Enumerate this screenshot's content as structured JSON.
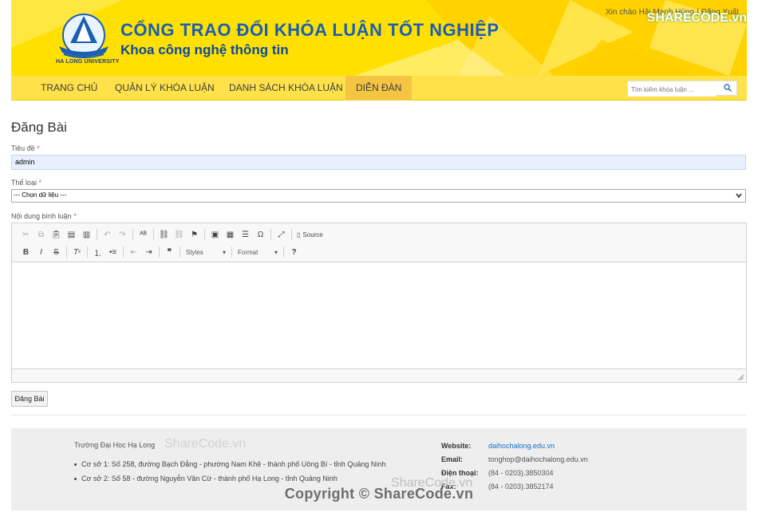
{
  "header": {
    "logo_caption": "HA LONG UNIVERSITY",
    "title": "CỔNG TRAO ĐỔI KHÓA LUẬN TỐT NGHIỆP",
    "subtitle": "Khoa công nghệ thông tin",
    "greeting_prefix": "Xin chào",
    "greeting_user": "Hải Mạnh Hùng",
    "logout": "Đăng Xuất",
    "watermark": "SHARECODE.vn"
  },
  "nav": {
    "items": [
      {
        "label": "TRANG CHỦ"
      },
      {
        "label": "QUẢN LÝ KHÓA LUẬN"
      },
      {
        "label": "DANH SÁCH KHÓA LUẬN"
      },
      {
        "label": "DIỄN ĐÀN"
      }
    ],
    "active_index": 3,
    "search_placeholder": "Tìm kiếm khóa luận ..."
  },
  "form": {
    "heading": "Đăng Bài",
    "title_label": "Tiêu đề",
    "title_value": "admin",
    "category_label": "Thể loại",
    "category_selected": "--- Chọn dữ liệu ---",
    "content_label": "Nội dung bình luận",
    "required_mark": "*",
    "submit_label": "Đăng Bài"
  },
  "editor": {
    "styles_label": "Styles",
    "format_label": "Format",
    "source_label": "Source"
  },
  "footer": {
    "school": "Trường Đại Học Hạ Long",
    "campuses": [
      "Cơ sở 1: Số 258, đường Bạch Đằng - phường Nam Khê - thành phố Uông Bí - tỉnh Quảng Ninh",
      "Cơ sở 2: Số 58 - đường Nguyễn Văn Cừ - thành phố Hạ Long - tỉnh Quảng Ninh"
    ],
    "website_label": "Website:",
    "website": "daihochalong.edu.vn",
    "email_label": "Email:",
    "email": "tonghop@daihochalong.edu.vn",
    "phone_label": "Điện thoại:",
    "phone": "(84 - 0203).3850304",
    "fax_label": "Fax:",
    "fax": "(84 - 0203).3852174"
  },
  "watermark": {
    "copyright": "Copyright © ShareCode.vn",
    "brand": "ShareCode.vn"
  },
  "colors": {
    "header_yellow": "#ffe000",
    "nav_active": "#f5c542",
    "title_blue": "#1a5fb4",
    "link_blue": "#1a6fc4"
  }
}
